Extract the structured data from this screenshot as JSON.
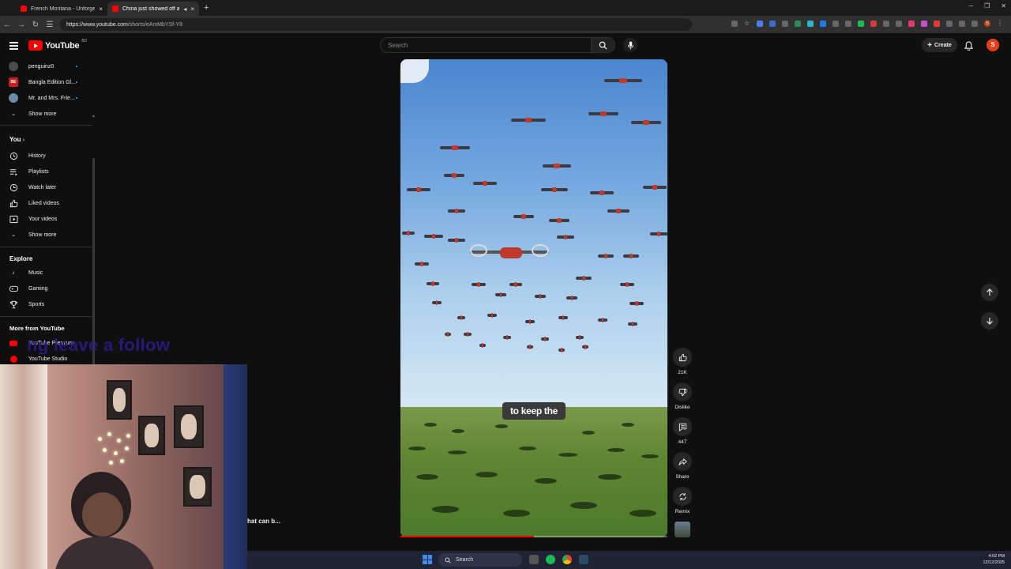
{
  "browser": {
    "tabs": [
      {
        "title": "French Montana - Unforgettab",
        "active": false
      },
      {
        "title": "China just showed off a dro",
        "active": true
      }
    ],
    "url": "https://www.youtube.com/shorts/eAmMbYSf-Y8",
    "url_host": "https://www.youtube.com",
    "url_path": "/shorts/eAmMbYSf-Y8",
    "new_tab_label": "+"
  },
  "youtube": {
    "logo_text": "YouTube",
    "country_code": "BD",
    "search_placeholder": "Search",
    "create_label": "Create",
    "avatar_letter": "S",
    "accent": "#ff0000"
  },
  "sidebar": {
    "subscriptions": [
      {
        "name": "penguinz0"
      },
      {
        "name": "Bangla Edition Gl..."
      },
      {
        "name": "Mr. and Mrs. Frie..."
      }
    ],
    "show_more_1": "Show more",
    "you_heading": "You",
    "you_items": [
      {
        "label": "History",
        "icon": "history-icon"
      },
      {
        "label": "Playlists",
        "icon": "playlists-icon"
      },
      {
        "label": "Watch later",
        "icon": "watch-later-icon"
      },
      {
        "label": "Liked videos",
        "icon": "like-icon"
      },
      {
        "label": "Your videos",
        "icon": "your-videos-icon"
      }
    ],
    "show_more_2": "Show more",
    "explore_heading": "Explore",
    "explore_items": [
      {
        "label": "Music",
        "icon": "music-icon"
      },
      {
        "label": "Gaming",
        "icon": "gaming-icon"
      },
      {
        "label": "Sports",
        "icon": "trophy-icon"
      }
    ],
    "more_heading": "More from YouTube",
    "more_items": [
      {
        "label": "YouTube Premium"
      },
      {
        "label": "YouTube Studio"
      }
    ]
  },
  "short": {
    "caption": "to keep the",
    "progress": 0.5,
    "behind_overlay_text": "hat can b..."
  },
  "actions": {
    "like_count": "21K",
    "dislike_label": "Dislike",
    "comment_count": "447",
    "share_label": "Share",
    "remix_label": "Remix"
  },
  "webcam": {
    "overlay_text": "ng leave a follow"
  },
  "taskbar": {
    "search_label": "Search",
    "time": "4:02 PM",
    "date": "12/12/2025"
  }
}
